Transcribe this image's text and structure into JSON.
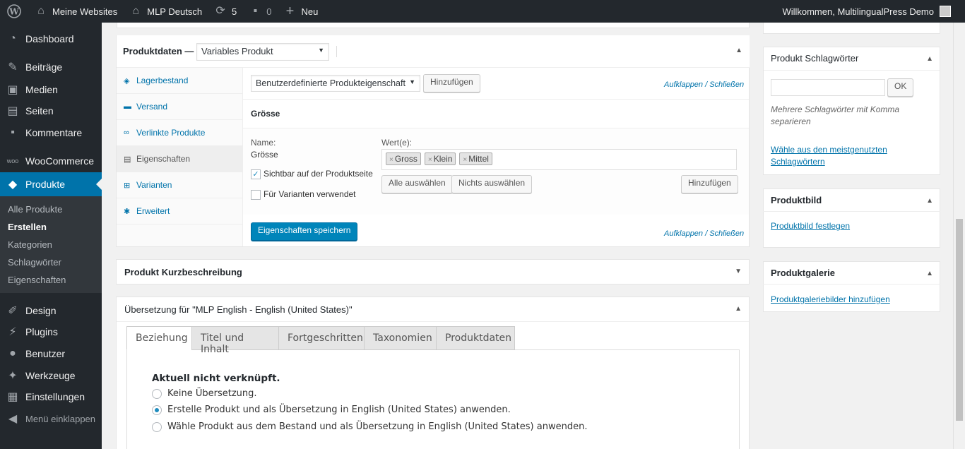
{
  "adminbar": {
    "sites": "Meine Websites",
    "site_name": "MLP Deutsch",
    "updates": "5",
    "comments": "0",
    "new": "Neu",
    "greeting": "Willkommen, MultilingualPress Demo"
  },
  "sidebar": {
    "items": [
      {
        "label": "Dashboard",
        "icon": "dashboard-icon"
      },
      {
        "label": "Beiträge",
        "icon": "pin-icon"
      },
      {
        "label": "Medien",
        "icon": "media-icon"
      },
      {
        "label": "Seiten",
        "icon": "pages-icon"
      },
      {
        "label": "Kommentare",
        "icon": "comment-icon"
      },
      {
        "label": "WooCommerce",
        "icon": "woo-icon"
      },
      {
        "label": "Produkte",
        "icon": "box-icon"
      },
      {
        "label": "Design",
        "icon": "brush-icon"
      },
      {
        "label": "Plugins",
        "icon": "plugin-icon"
      },
      {
        "label": "Benutzer",
        "icon": "user-icon"
      },
      {
        "label": "Werkzeuge",
        "icon": "wrench-icon"
      },
      {
        "label": "Einstellungen",
        "icon": "settings-icon"
      }
    ],
    "submenu": [
      "Alle Produkte",
      "Erstellen",
      "Kategorien",
      "Schlagwörter",
      "Eigenschaften"
    ],
    "collapse": "Menü einklappen"
  },
  "product_data": {
    "title": "Produktdaten —",
    "type_select": "Variables Produkt",
    "tabs": [
      {
        "label": "Lagerbestand",
        "icon": "inventory-icon"
      },
      {
        "label": "Versand",
        "icon": "truck-icon"
      },
      {
        "label": "Verlinkte Produkte",
        "icon": "link-icon"
      },
      {
        "label": "Eigenschaften",
        "icon": "attributes-icon"
      },
      {
        "label": "Varianten",
        "icon": "variations-icon"
      },
      {
        "label": "Erweitert",
        "icon": "gear-icon"
      }
    ],
    "attribute_select": "Benutzerdefinierte Produkteigenschaft",
    "add_button": "Hinzufügen",
    "expand": "Aufklappen",
    "sep": " / ",
    "close": "Schließen",
    "attribute_heading": "Grösse",
    "name_label": "Name:",
    "name_value": "Grösse",
    "values_label": "Wert(e):",
    "tags": [
      "Gross",
      "Klein",
      "Mittel"
    ],
    "visible_label": "Sichtbar auf der Produktseite",
    "variations_label": "Für Varianten verwendet",
    "select_all": "Alle auswählen",
    "select_none": "Nichts auswählen",
    "add_value": "Hinzufügen",
    "save": "Eigenschaften speichern"
  },
  "short_desc": {
    "title": "Produkt Kurzbeschreibung"
  },
  "translation": {
    "title": "Übersetzung für \"MLP English - English (United States)\"",
    "tabs": [
      "Beziehung",
      "Titel und Inhalt",
      "Fortgeschritten",
      "Taxonomien",
      "Produktdaten"
    ],
    "status": "Aktuell nicht verknüpft.",
    "options": [
      "Keine Übersetzung.",
      "Erstelle Produkt und als Übersetzung in English (United States) anwenden.",
      "Wähle Produkt aus dem Bestand und als Übersetzung in English (United States) anwenden."
    ]
  },
  "tags_box": {
    "title": "Produkt Schlagwörter",
    "ok": "OK",
    "hint": "Mehrere Schlagwörter mit Komma separieren",
    "popular": "Wähle aus den meistgenutzten Schlagwörtern"
  },
  "image_box": {
    "title": "Produktbild",
    "link": "Produktbild festlegen"
  },
  "gallery_box": {
    "title": "Produktgalerie",
    "link": "Produktgaleriebilder hinzufügen"
  }
}
